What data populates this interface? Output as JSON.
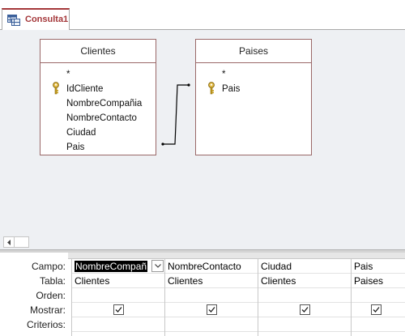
{
  "tab": {
    "icon": "query-icon",
    "label": "Consulta1"
  },
  "tables": [
    {
      "id": "clientes",
      "title": "Clientes",
      "fields": [
        {
          "name": "*",
          "key": false
        },
        {
          "name": "IdCliente",
          "key": true
        },
        {
          "name": "NombreCompañia",
          "key": false
        },
        {
          "name": "NombreContacto",
          "key": false
        },
        {
          "name": "Ciudad",
          "key": false
        },
        {
          "name": "Pais",
          "key": false
        }
      ]
    },
    {
      "id": "paises",
      "title": "Paises",
      "fields": [
        {
          "name": "*",
          "key": false
        },
        {
          "name": "Pais",
          "key": true
        }
      ]
    }
  ],
  "relationship": {
    "from": "Clientes.Pais",
    "to": "Paises.Pais"
  },
  "grid": {
    "row_labels": [
      "Campo:",
      "Tabla:",
      "Orden:",
      "Mostrar:",
      "Criterios:"
    ],
    "columns": [
      {
        "campo": "NombreCompañ",
        "tabla": "Clientes",
        "orden": "",
        "mostrar": true,
        "selected": true
      },
      {
        "campo": "NombreContacto",
        "tabla": "Clientes",
        "orden": "",
        "mostrar": true,
        "selected": false
      },
      {
        "campo": "Ciudad",
        "tabla": "Clientes",
        "orden": "",
        "mostrar": true,
        "selected": false
      },
      {
        "campo": "Pais",
        "tabla": "Paises",
        "orden": "",
        "mostrar": true,
        "selected": false
      }
    ]
  },
  "colors": {
    "accent": "#a4373a",
    "table_border": "#9a6868",
    "design_bg": "#eef0f3",
    "key": "#c8a020"
  }
}
